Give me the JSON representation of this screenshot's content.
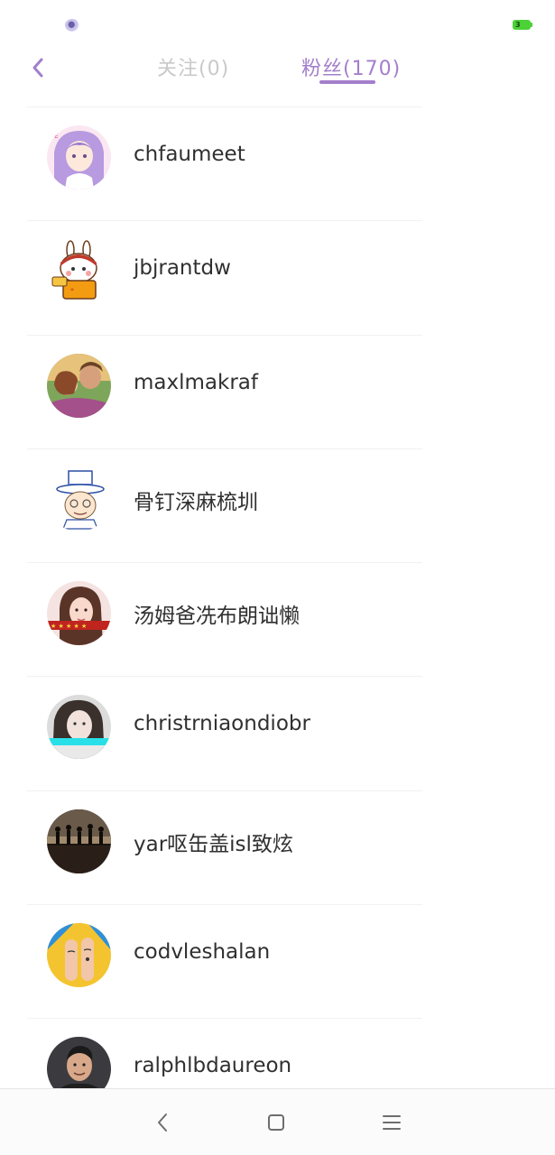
{
  "status_bar": {
    "battery_level": "3",
    "battery_color": "#4cd137"
  },
  "header": {
    "tabs": [
      {
        "label": "关注(0)",
        "active": false
      },
      {
        "label": "粉丝(170)",
        "active": true
      }
    ],
    "accent_color": "#a37fcb"
  },
  "fans": [
    {
      "name": "chfaumeet",
      "avatar": "anime-girl-avatar"
    },
    {
      "name": "jbjrantdw",
      "avatar": "bunny-cartoon-avatar"
    },
    {
      "name": "maxlmakraf",
      "avatar": "couple-photo-avatar"
    },
    {
      "name": "骨钉深麻梳圳",
      "avatar": "kid-top-hat-cartoon-avatar"
    },
    {
      "name": "汤姆爸冼布朗诎懒",
      "avatar": "girl-photo-avatar"
    },
    {
      "name": "christrniaondiobr",
      "avatar": "girl-portrait-avatar"
    },
    {
      "name": "yar呕缶盖isl致炫",
      "avatar": "silhouettes-sunset-avatar"
    },
    {
      "name": "codvleshalan",
      "avatar": "finger-faces-avatar"
    },
    {
      "name": "ralphlbdaureon",
      "avatar": "man-portrait-avatar"
    }
  ],
  "bottom_nav": [
    "back-icon",
    "home-icon",
    "menu-icon"
  ]
}
